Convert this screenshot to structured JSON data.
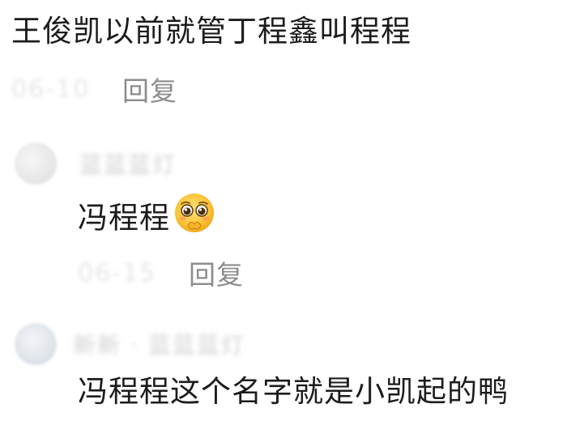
{
  "comments": [
    {
      "text": "王俊凯以前就管丁程鑫叫程程",
      "timestamp": "06-10",
      "reply_label": "回复"
    },
    {
      "username": "蓝蓝蓝灯",
      "text": "冯程程",
      "emoji": "pleading-face-emoji",
      "timestamp": "06-15",
      "reply_label": "回复"
    },
    {
      "username": "新新 · 蓝蓝蓝灯",
      "text": "冯程程这个名字就是小凯起的鸭"
    }
  ]
}
